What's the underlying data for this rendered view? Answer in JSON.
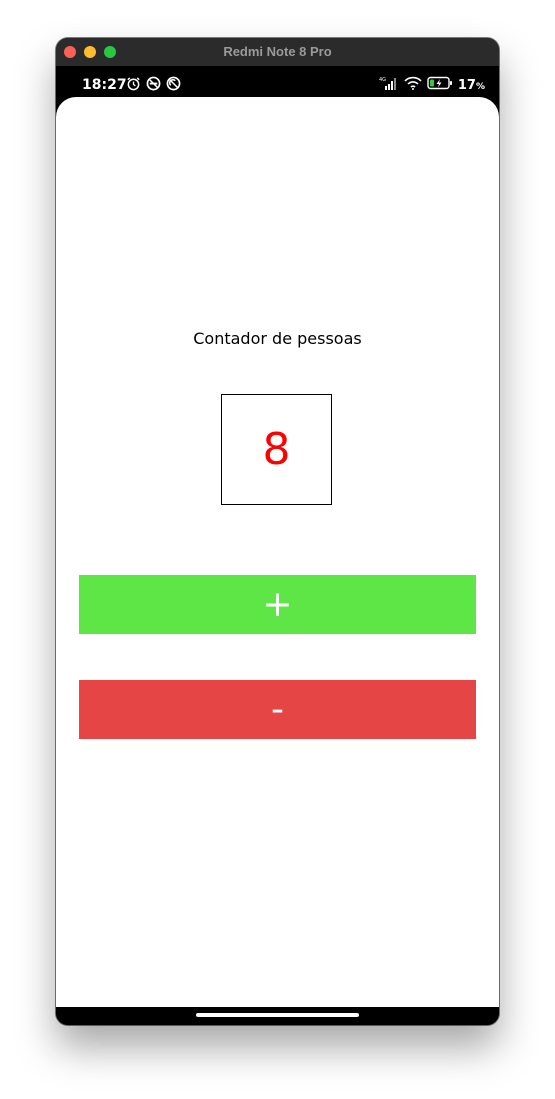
{
  "window": {
    "title": "Redmi Note 8 Pro"
  },
  "status_bar": {
    "time": "18:27",
    "left_icons": [
      "alarm-icon",
      "do-not-disturb-icon",
      "sync-off-icon"
    ],
    "right_icons": [
      "signal-4g-icon",
      "wifi-icon",
      "battery-charging-icon"
    ],
    "battery_percent": "17",
    "battery_unit": "%"
  },
  "app": {
    "title": "Contador de pessoas",
    "counter_value": "8",
    "counter_color": "#ff0000",
    "increment_label": "+",
    "increment_color": "#5ee646",
    "decrement_label": "-",
    "decrement_color": "#e54545"
  }
}
